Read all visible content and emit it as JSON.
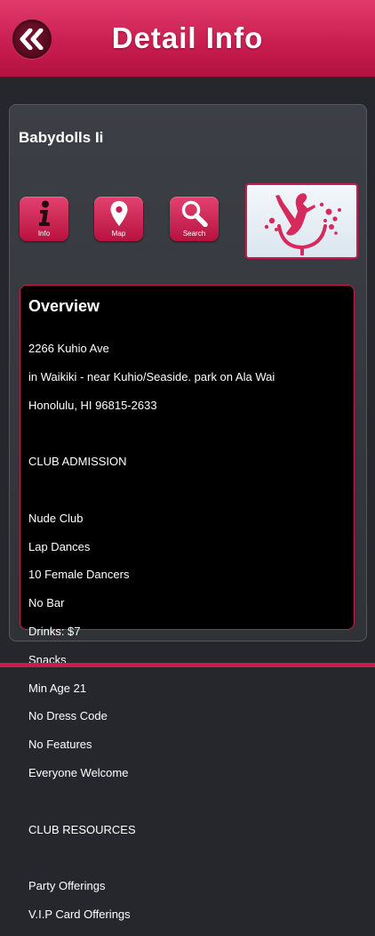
{
  "header": {
    "title": "Detail Info"
  },
  "club": {
    "name": "Babydolls Ii"
  },
  "actions": [
    {
      "label": "Info",
      "icon": "info-icon"
    },
    {
      "label": "Map",
      "icon": "map-pin-icon"
    },
    {
      "label": "Search",
      "icon": "search-icon"
    }
  ],
  "overview": {
    "heading": "Overview",
    "lines": [
      "2266 Kuhio Ave",
      "in Waikiki - near Kuhio/Seaside. park on Ala Wai",
      "Honolulu, HI 96815-2633",
      "",
      "CLUB ADMISSION",
      "",
      "Nude Club",
      "Lap Dances",
      "10 Female Dancers",
      "No Bar",
      "Drinks: $7",
      "Snacks",
      "Min Age 21",
      "No Dress Code",
      "No Features",
      "Everyone Welcome",
      "",
      "CLUB RESOURCES",
      "",
      "Party Offerings",
      "V.I.P Card Offerings"
    ]
  },
  "colors": {
    "accent": "#c81c4f",
    "background": "#25272c"
  }
}
